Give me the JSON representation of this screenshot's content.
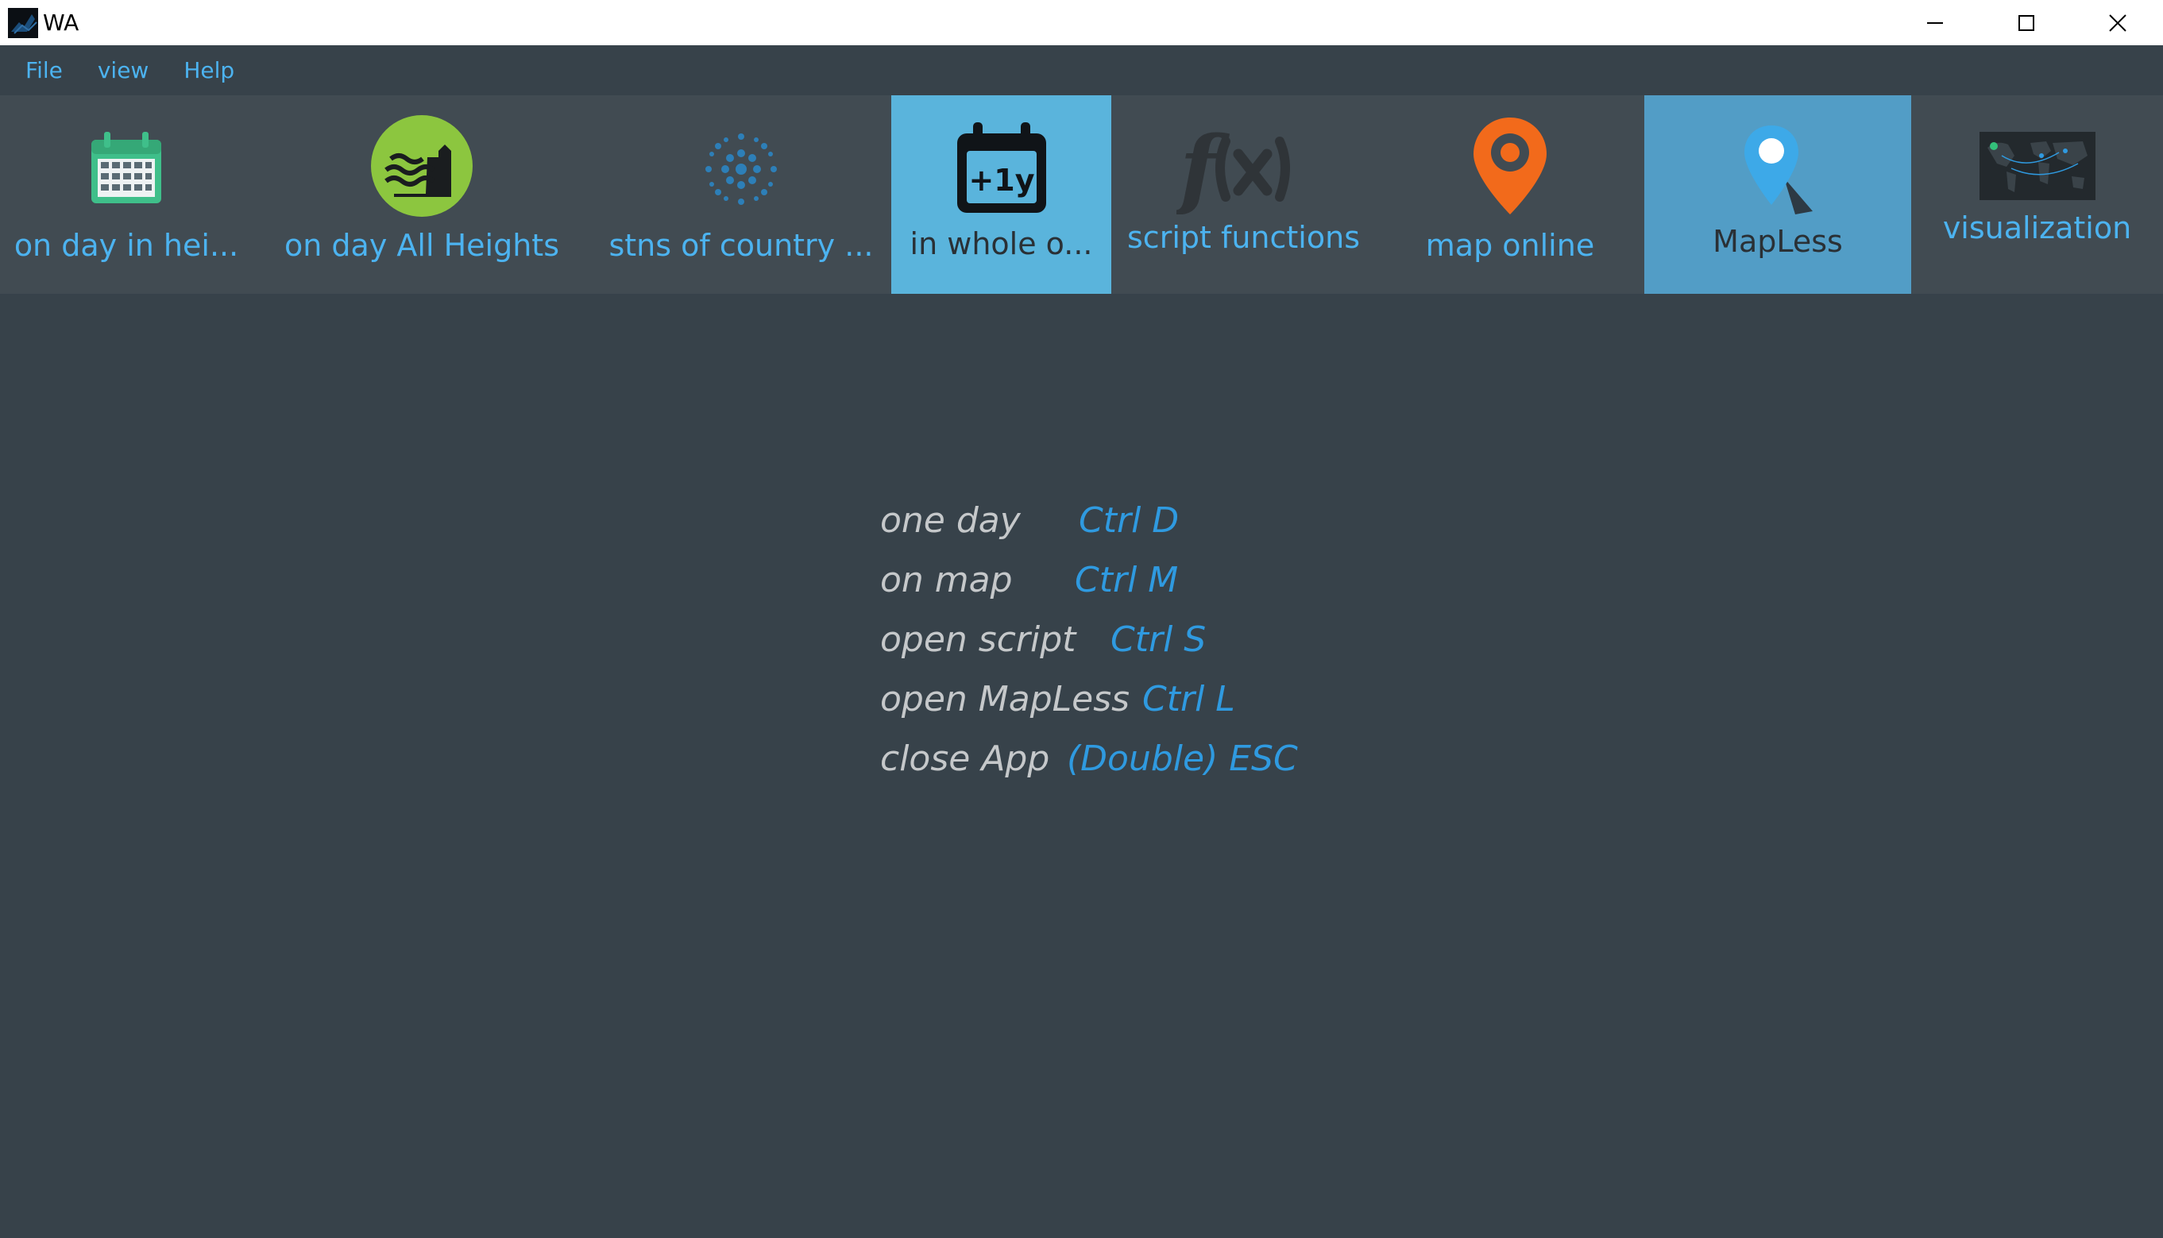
{
  "window": {
    "title": "WA",
    "controls": [
      "minimize-icon",
      "maximize-icon",
      "close-icon"
    ]
  },
  "menu": {
    "items": [
      "File",
      "view",
      "Help"
    ]
  },
  "toolbar": {
    "tools": [
      {
        "label": "on day in hei...",
        "icon": "calendar-grid-icon"
      },
      {
        "label": "on day All Heights",
        "icon": "heights-waves-icon"
      },
      {
        "label": "stns of country ...",
        "icon": "dots-cluster-icon"
      },
      {
        "label": "in whole o...",
        "icon": "calendar-plus-year-icon",
        "icon_text": "+1y"
      },
      {
        "label": "script functions",
        "icon": "function-fx-icon"
      },
      {
        "label": "map online",
        "icon": "map-pin-orange-icon"
      },
      {
        "label": "MapLess",
        "icon": "map-pin-blue-icon"
      },
      {
        "label": "visualization",
        "icon": "world-map-icon"
      }
    ]
  },
  "shortcuts": [
    {
      "action": "one day",
      "key": "Ctrl D"
    },
    {
      "action": "on  map",
      "key": "Ctrl M"
    },
    {
      "action": "open script",
      "key": "Ctrl S"
    },
    {
      "action": "open MapLess",
      "key": "Ctrl L"
    },
    {
      "action": "close App",
      "key": "(Double) ESC"
    }
  ],
  "colors": {
    "background": "#37424a",
    "toolbar": "#414b52",
    "accent_blue": "#4cb3f0",
    "active_tool": "#5ab4dc",
    "selected_tool": "#529dc6",
    "shortcut_key": "#2f9ae0"
  }
}
